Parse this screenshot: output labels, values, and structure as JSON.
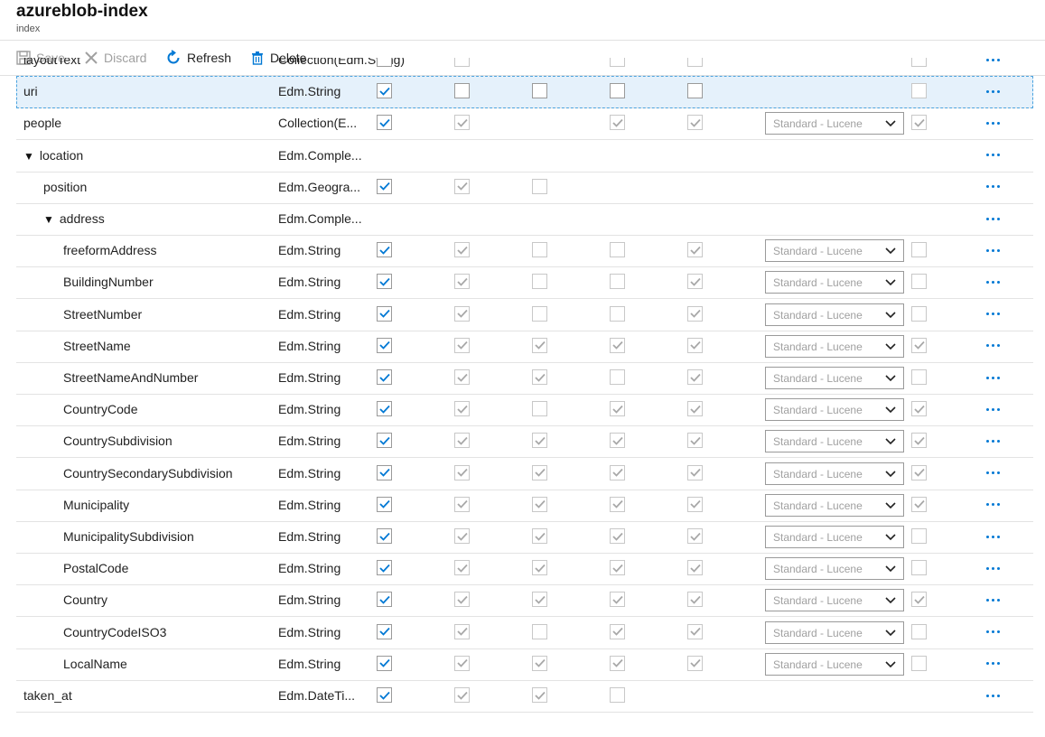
{
  "header": {
    "title": "azureblob-index",
    "subtitle": "index"
  },
  "toolbar": {
    "save": "Save",
    "discard": "Discard",
    "refresh": "Refresh",
    "delete": "Delete"
  },
  "analyzer_label": "Standard - Lucene",
  "colors": {
    "accent": "#0078d4",
    "selected_bg": "#e5f1fb",
    "disabled": "#a0a0a0"
  },
  "rows": [
    {
      "name": "layoutText",
      "type": "Collection(Edm.String)",
      "indent": 0,
      "checks": [
        0,
        0,
        null,
        0,
        0
      ],
      "analyzer": false,
      "last": 0
    },
    {
      "name": "uri",
      "type": "Edm.String",
      "indent": 0,
      "selected": true,
      "checks": [
        1,
        0,
        0,
        0,
        0
      ],
      "checks_enabled": true,
      "analyzer": false,
      "last": 0
    },
    {
      "name": "people",
      "type": "Collection(E...",
      "indent": 0,
      "checks": [
        1,
        1,
        null,
        1,
        1
      ],
      "analyzer": true,
      "last": 1
    },
    {
      "name": "location",
      "type": "Edm.Comple...",
      "indent": 0,
      "expander": "▼",
      "checks": [
        null,
        null,
        null,
        null,
        null
      ],
      "analyzer": false,
      "last": null
    },
    {
      "name": "position",
      "type": "Edm.Geogra...",
      "indent": 1,
      "checks": [
        1,
        1,
        0,
        null,
        null
      ],
      "analyzer": false,
      "last": null
    },
    {
      "name": "address",
      "type": "Edm.Comple...",
      "indent": 1,
      "expander": "▼",
      "checks": [
        null,
        null,
        null,
        null,
        null
      ],
      "analyzer": false,
      "last": null
    },
    {
      "name": "freeformAddress",
      "type": "Edm.String",
      "indent": 2,
      "checks": [
        1,
        1,
        0,
        0,
        1
      ],
      "analyzer": true,
      "last": 0
    },
    {
      "name": "BuildingNumber",
      "type": "Edm.String",
      "indent": 2,
      "checks": [
        1,
        1,
        0,
        0,
        1
      ],
      "analyzer": true,
      "last": 0
    },
    {
      "name": "StreetNumber",
      "type": "Edm.String",
      "indent": 2,
      "checks": [
        1,
        1,
        0,
        0,
        1
      ],
      "analyzer": true,
      "last": 0
    },
    {
      "name": "StreetName",
      "type": "Edm.String",
      "indent": 2,
      "checks": [
        1,
        1,
        1,
        1,
        1
      ],
      "analyzer": true,
      "last": 1
    },
    {
      "name": "StreetNameAndNumber",
      "type": "Edm.String",
      "indent": 2,
      "checks": [
        1,
        1,
        1,
        0,
        1
      ],
      "analyzer": true,
      "last": 0
    },
    {
      "name": "CountryCode",
      "type": "Edm.String",
      "indent": 2,
      "checks": [
        1,
        1,
        0,
        1,
        1
      ],
      "analyzer": true,
      "last": 1
    },
    {
      "name": "CountrySubdivision",
      "type": "Edm.String",
      "indent": 2,
      "checks": [
        1,
        1,
        1,
        1,
        1
      ],
      "analyzer": true,
      "last": 1
    },
    {
      "name": "CountrySecondarySubdivision",
      "type": "Edm.String",
      "indent": 2,
      "checks": [
        1,
        1,
        1,
        1,
        1
      ],
      "analyzer": true,
      "last": 1
    },
    {
      "name": "Municipality",
      "type": "Edm.String",
      "indent": 2,
      "checks": [
        1,
        1,
        1,
        1,
        1
      ],
      "analyzer": true,
      "last": 1
    },
    {
      "name": "MunicipalitySubdivision",
      "type": "Edm.String",
      "indent": 2,
      "checks": [
        1,
        1,
        1,
        1,
        1
      ],
      "analyzer": true,
      "last": 0
    },
    {
      "name": "PostalCode",
      "type": "Edm.String",
      "indent": 2,
      "checks": [
        1,
        1,
        1,
        1,
        1
      ],
      "analyzer": true,
      "last": 0
    },
    {
      "name": "Country",
      "type": "Edm.String",
      "indent": 2,
      "checks": [
        1,
        1,
        1,
        1,
        1
      ],
      "analyzer": true,
      "last": 1
    },
    {
      "name": "CountryCodeISO3",
      "type": "Edm.String",
      "indent": 2,
      "checks": [
        1,
        1,
        0,
        1,
        1
      ],
      "analyzer": true,
      "last": 0
    },
    {
      "name": "LocalName",
      "type": "Edm.String",
      "indent": 2,
      "checks": [
        1,
        1,
        1,
        1,
        1
      ],
      "analyzer": true,
      "last": 0
    },
    {
      "name": "taken_at",
      "type": "Edm.DateTi...",
      "indent": 0,
      "checks": [
        1,
        1,
        1,
        0,
        null
      ],
      "analyzer": false,
      "last": null
    }
  ]
}
